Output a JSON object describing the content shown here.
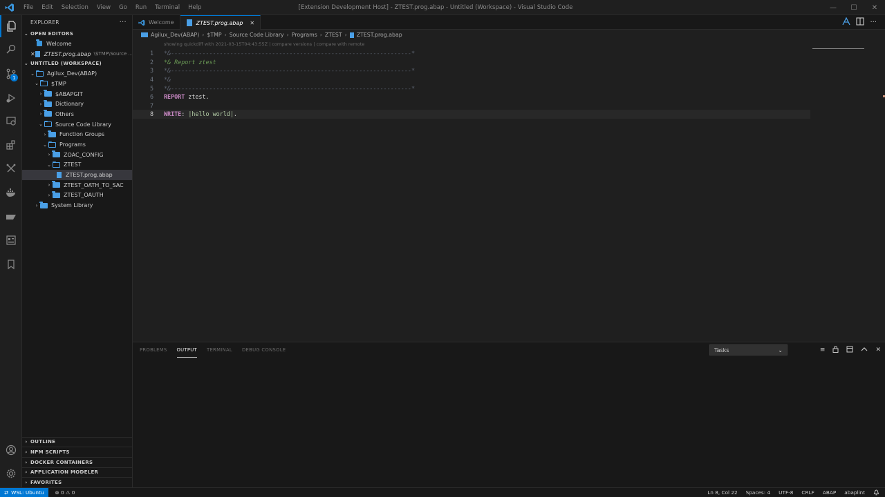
{
  "titlebar": {
    "menu": [
      "File",
      "Edit",
      "Selection",
      "View",
      "Go",
      "Run",
      "Terminal",
      "Help"
    ],
    "title": "[Extension Development Host] - ZTEST.prog.abap - Untitled (Workspace) - Visual Studio Code",
    "controls": [
      "—",
      "☐",
      "✕"
    ]
  },
  "colors": {
    "accent": "#0078d4",
    "folder": "#4a9fe6",
    "keyword": "#c586c0",
    "comment": "#6a9955"
  },
  "activitybar": {
    "icons": [
      "explorer-icon",
      "search-icon",
      "source-control-icon",
      "run-debug-icon",
      "remote-explorer-icon",
      "extensions-icon",
      "testing-icon",
      "docker-icon",
      "abap-icon",
      "sap-icon",
      "bookmark-icon",
      "account-icon",
      "settings-icon"
    ],
    "source_control_badge": "1"
  },
  "sidebar": {
    "header": "EXPLORER",
    "more": "···",
    "open_editors": {
      "title": "OPEN EDITORS",
      "items": [
        {
          "label": "Welcome",
          "desc": ""
        },
        {
          "label": "ZTEST.prog.abap",
          "desc": "\\$TMP\\Source ..."
        }
      ]
    },
    "workspace": {
      "title": "UNTITLED (WORKSPACE)",
      "tree": [
        {
          "label": "Agilux_Dev(ABAP)"
        },
        {
          "label": "$TMP"
        },
        {
          "label": "$ABAPGIT"
        },
        {
          "label": "Dictionary"
        },
        {
          "label": "Others"
        },
        {
          "label": "Source Code Library"
        },
        {
          "label": "Function Groups"
        },
        {
          "label": "Programs"
        },
        {
          "label": "ZOAC_CONFIG"
        },
        {
          "label": "ZTEST"
        },
        {
          "label": "ZTEST.prog.abap"
        },
        {
          "label": "ZTEST_OATH_TO_SAC"
        },
        {
          "label": "ZTEST_OAUTH"
        },
        {
          "label": "System Library"
        }
      ]
    },
    "bottom_sections": [
      "OUTLINE",
      "NPM SCRIPTS",
      "DOCKER CONTAINERS",
      "APPLICATION MODELER",
      "FAVORITES"
    ]
  },
  "tabs": [
    {
      "label": "Welcome"
    },
    {
      "label": "ZTEST.prog.abap",
      "close": "✕"
    }
  ],
  "breadcrumb": [
    "Agilux_Dev(ABAP)",
    "$TMP",
    "Source Code Library",
    "Programs",
    "ZTEST",
    "ZTEST.prog.abap"
  ],
  "breadcrumb_sep": "›",
  "editor": {
    "codelens": "showing quickdiff with 2021-03-15T04:43:55Z | compare versions | compare with remote",
    "lines": [
      {
        "n": "1",
        "parts": [
          {
            "t": "*&---------------------------------------------------------------------*",
            "c": "c-comment dim"
          }
        ]
      },
      {
        "n": "2",
        "parts": [
          {
            "t": "*& Report ztest",
            "c": "c-comment"
          }
        ]
      },
      {
        "n": "3",
        "parts": [
          {
            "t": "*&---------------------------------------------------------------------*",
            "c": "c-comment dim"
          }
        ]
      },
      {
        "n": "4",
        "parts": [
          {
            "t": "*&",
            "c": "c-comment dim"
          }
        ]
      },
      {
        "n": "5",
        "parts": [
          {
            "t": "*&---------------------------------------------------------------------*",
            "c": "c-comment dim"
          }
        ]
      },
      {
        "n": "6",
        "parts": [
          {
            "t": "REPORT",
            "c": "c-kw"
          },
          {
            "t": " ztest.",
            "c": "c-plain"
          }
        ]
      },
      {
        "n": "7",
        "parts": []
      },
      {
        "n": "8",
        "parts": [
          {
            "t": "WRITE",
            "c": "c-kw"
          },
          {
            "t": ": ",
            "c": "c-plain"
          },
          {
            "t": "|hello world|",
            "c": "c-str"
          },
          {
            "t": ".",
            "c": "c-plain"
          }
        ]
      }
    ],
    "current_line": 8
  },
  "panel": {
    "tabs": [
      "PROBLEMS",
      "OUTPUT",
      "TERMINAL",
      "DEBUG CONSOLE"
    ],
    "active_tab": "OUTPUT",
    "select_value": "Tasks",
    "actions": [
      "≡",
      "🔒",
      "⧉",
      "⌃",
      "✕"
    ]
  },
  "statusbar": {
    "remote": "WSL: Ubuntu",
    "problems": "⊗ 0 ⚠ 0",
    "right": [
      "Ln 8, Col 22",
      "Spaces: 4",
      "UTF-8",
      "CRLF",
      "ABAP",
      "abaplint"
    ]
  }
}
